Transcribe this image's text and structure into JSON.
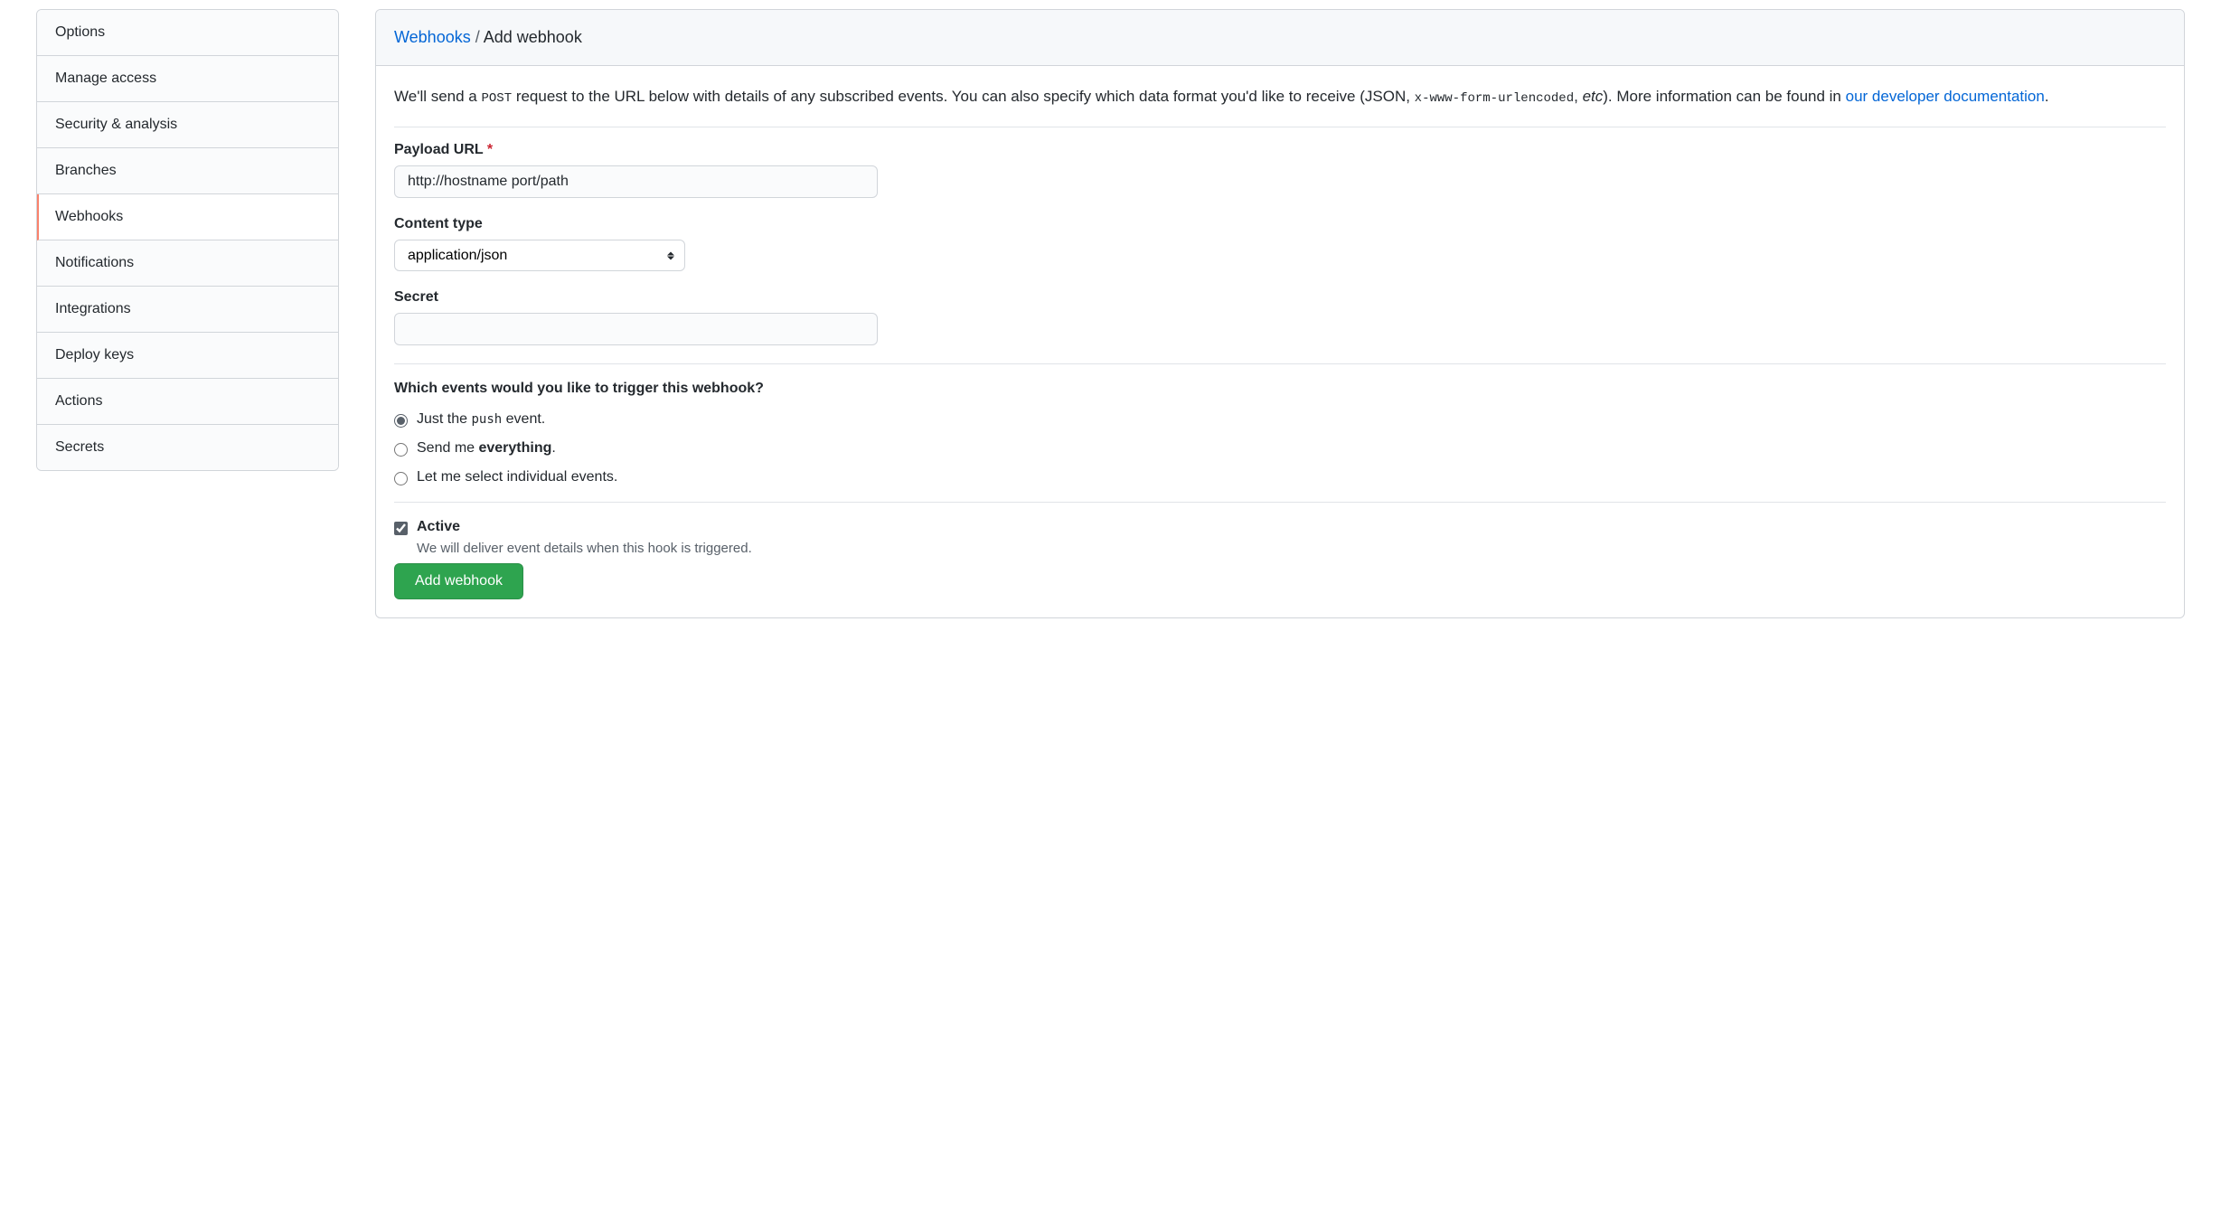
{
  "sidebar": {
    "items": [
      {
        "label": "Options"
      },
      {
        "label": "Manage access"
      },
      {
        "label": "Security & analysis"
      },
      {
        "label": "Branches"
      },
      {
        "label": "Webhooks"
      },
      {
        "label": "Notifications"
      },
      {
        "label": "Integrations"
      },
      {
        "label": "Deploy keys"
      },
      {
        "label": "Actions"
      },
      {
        "label": "Secrets"
      }
    ],
    "active_index": 4
  },
  "breadcrumb": {
    "link": "Webhooks",
    "sep": " / ",
    "current": "Add webhook"
  },
  "intro": {
    "pre_post": "We'll send a ",
    "post_code": "POST",
    "after_post": " request to the URL below with details of any subscribed events. You can also specify which data format you'd like to receive (JSON, ",
    "urlenc_code": "x-www-form-urlencoded",
    "after_urlenc": ", ",
    "etc": "etc",
    "after_etc": "). More information can be found in ",
    "doc_link": "our developer documentation",
    "period": "."
  },
  "form": {
    "payload_url": {
      "label": "Payload URL",
      "required_mark": "*",
      "placeholder": "",
      "value": "http://hostname port/path"
    },
    "content_type": {
      "label": "Content type",
      "value": "application/json"
    },
    "secret": {
      "label": "Secret",
      "value": ""
    },
    "events": {
      "heading": "Which events would you like to trigger this webhook?",
      "options": [
        {
          "pre": "Just the ",
          "code": "push",
          "post": " event."
        },
        {
          "pre": "Send me ",
          "strong": "everything",
          "post": "."
        },
        {
          "pre": "Let me select individual events.",
          "code": "",
          "post": ""
        }
      ],
      "selected_index": 0
    },
    "active": {
      "label": "Active",
      "note": "We will deliver event details when this hook is triggered.",
      "checked": true
    },
    "submit_label": "Add webhook"
  }
}
